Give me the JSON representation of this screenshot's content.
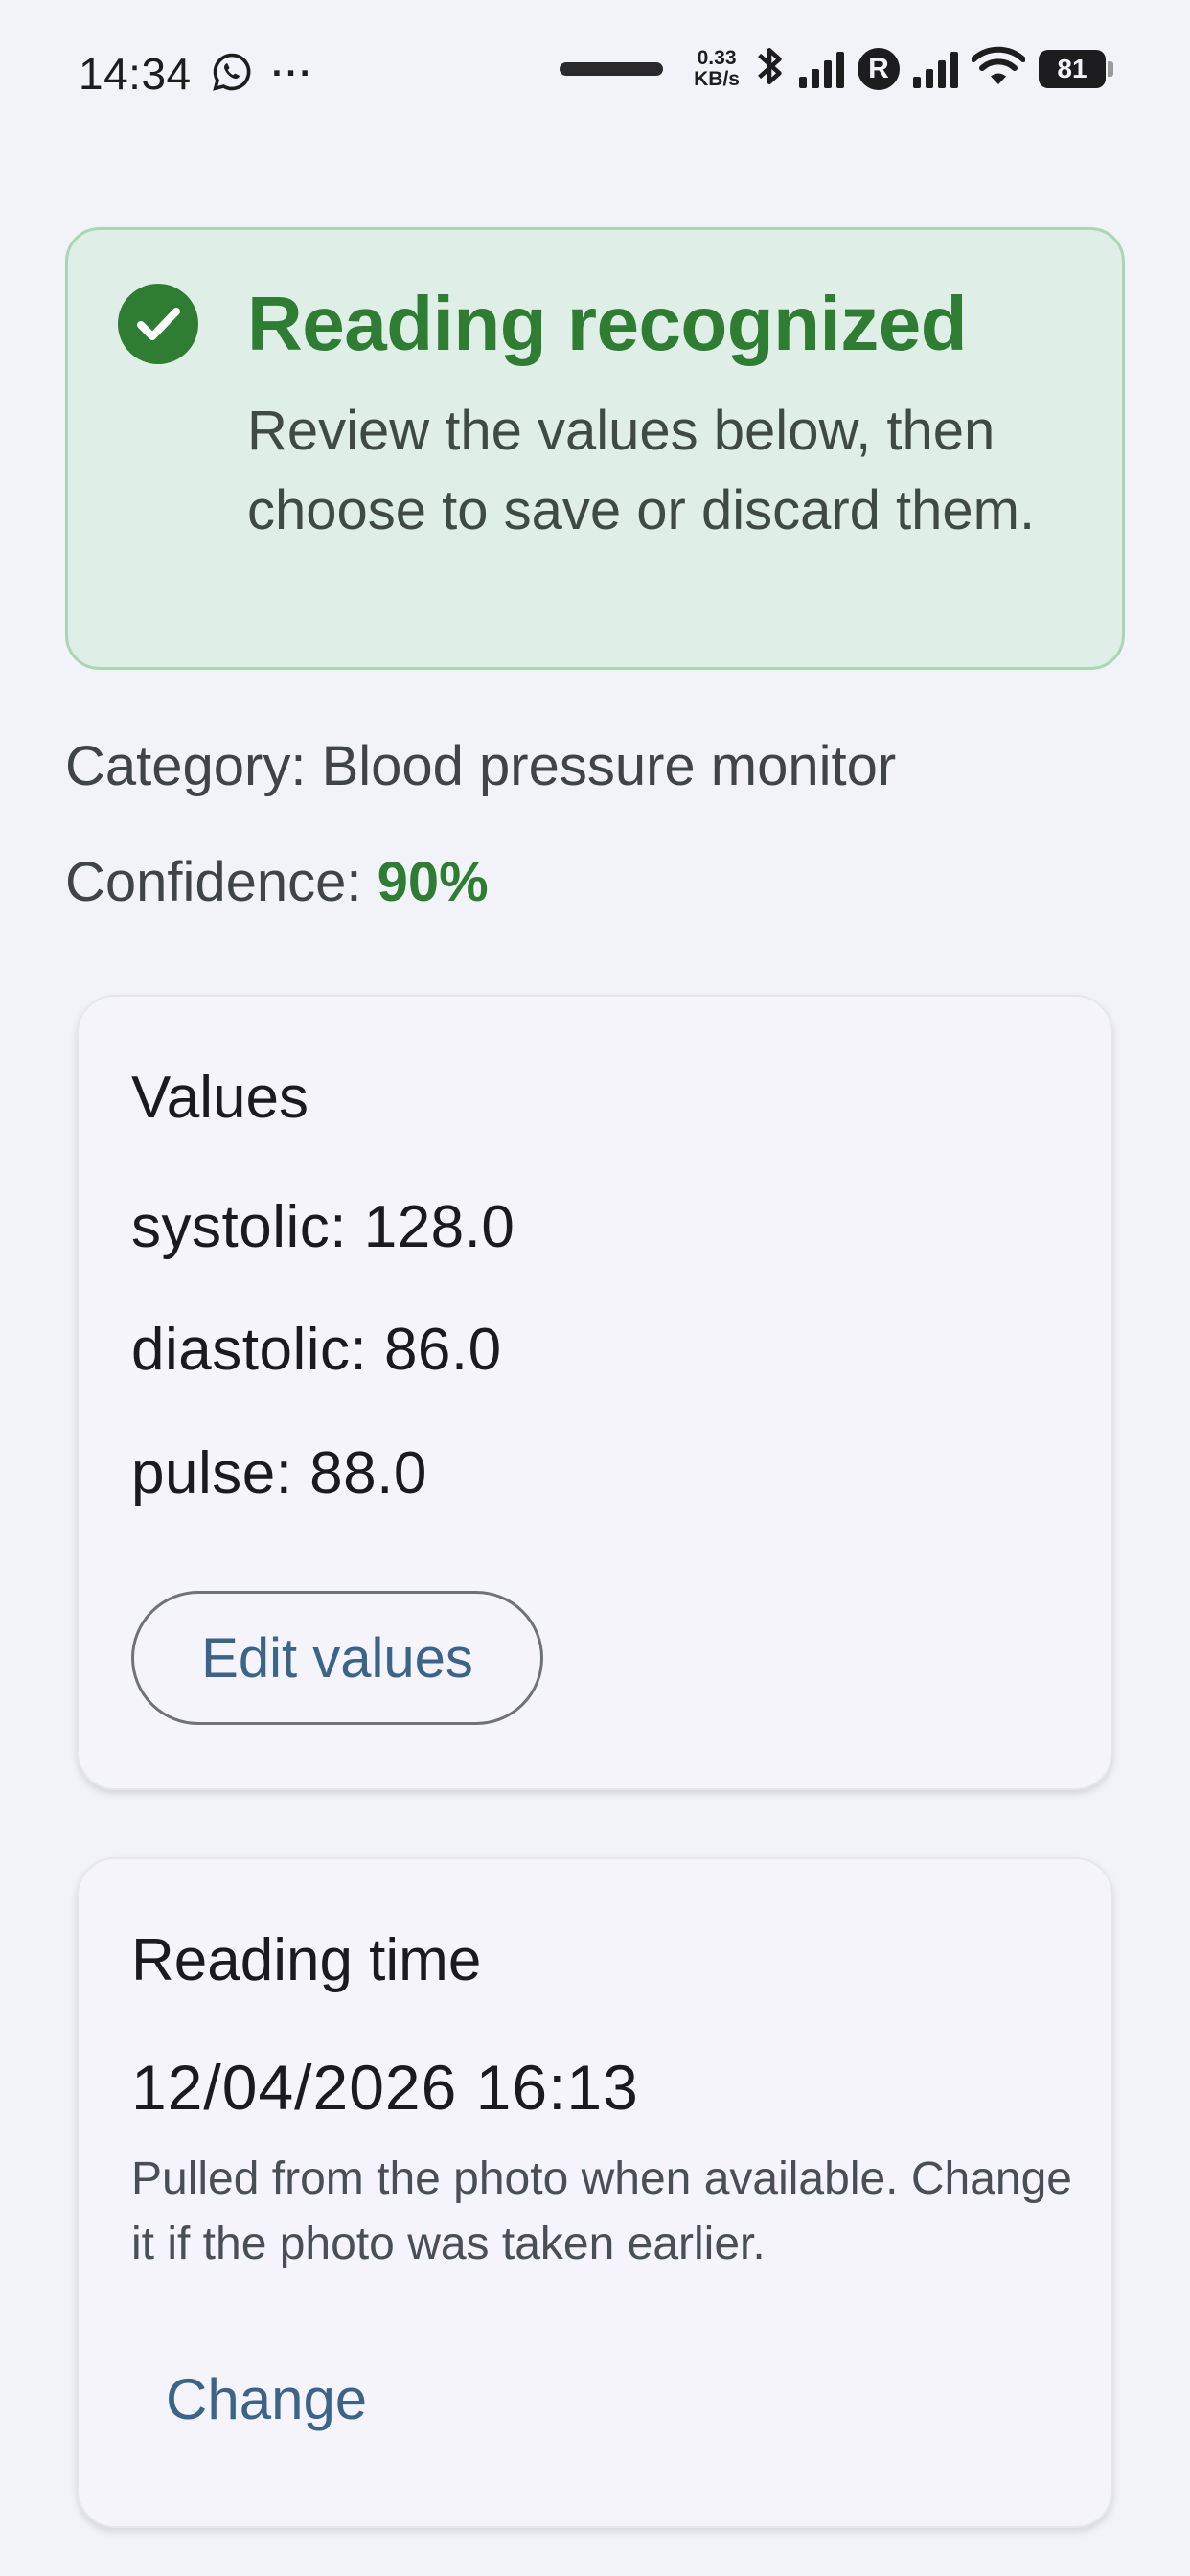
{
  "status_bar": {
    "time": "14:34",
    "net_speed_value": "0.33",
    "net_speed_unit": "KB/s",
    "roaming_label": "R",
    "battery": "81",
    "more_dots": "···"
  },
  "banner": {
    "title": "Reading recognized",
    "message": "Review the values below, then choose to save or discard them.",
    "accent_color": "#2e7d32"
  },
  "reading": {
    "category_label": "Category: ",
    "category_value": "Blood pressure monitor",
    "confidence_label": "Confidence: ",
    "confidence_value": "90%"
  },
  "values_card": {
    "title": "Values",
    "items": [
      {
        "text": "systolic: 128.0"
      },
      {
        "text": "diastolic: 86.0"
      },
      {
        "text": "pulse: 88.0"
      }
    ],
    "edit_button": "Edit values"
  },
  "time_card": {
    "title": "Reading time",
    "value": "12/04/2026 16:13",
    "hint": "Pulled from the photo when available. Change it if the photo was taken earlier.",
    "change_button": "Change"
  }
}
